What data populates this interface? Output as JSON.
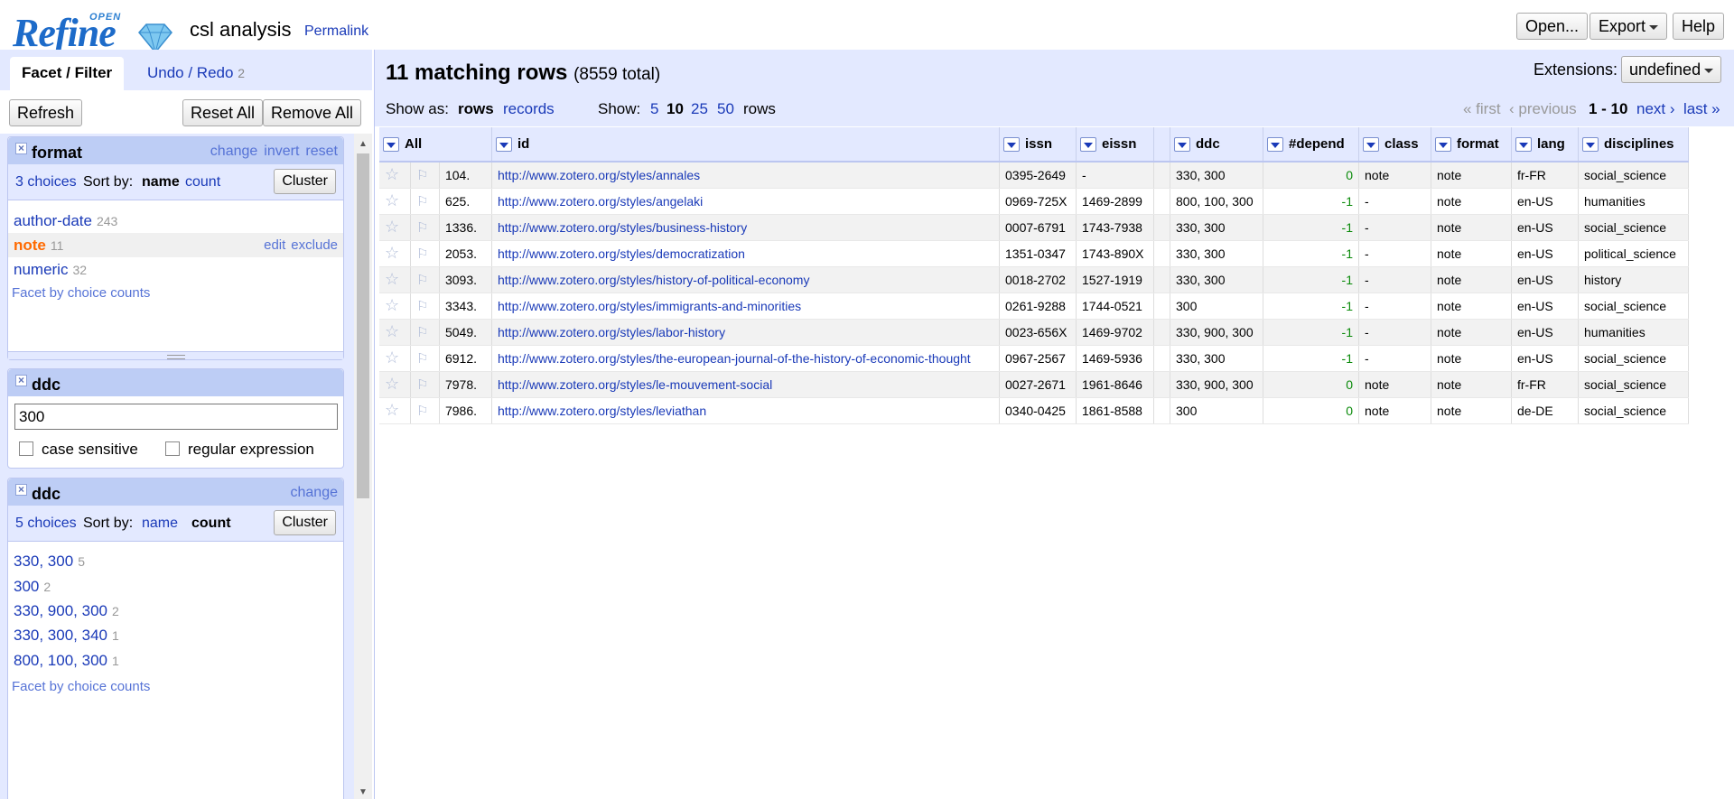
{
  "header": {
    "logo_open": "OPEN",
    "logo_refine": "Refine",
    "project_title": "csl analysis",
    "permalink": "Permalink",
    "buttons": {
      "open": "Open...",
      "export": "Export",
      "help": "Help"
    }
  },
  "left": {
    "tabs": {
      "facet_filter": "Facet / Filter",
      "undo_redo": "Undo / Redo",
      "undo_count": "2"
    },
    "refresh": "Refresh",
    "reset_all": "Reset All",
    "remove_all": "Remove All",
    "facet_format": {
      "title": "format",
      "actions": [
        "change",
        "invert",
        "reset"
      ],
      "choices_count": "3 choices",
      "sort_by": "Sort by:",
      "sort_name": "name",
      "sort_count": "count",
      "cluster": "Cluster",
      "choices": [
        {
          "label": "author-date",
          "count": "243"
        },
        {
          "label": "note",
          "count": "11",
          "edit": "edit",
          "exclude": "exclude"
        },
        {
          "label": "numeric",
          "count": "32"
        }
      ],
      "footer": "Facet by choice counts"
    },
    "facet_ddc_text": {
      "title": "ddc",
      "value": "300",
      "case_sensitive": "case sensitive",
      "regular_expression": "regular expression"
    },
    "facet_ddc_list": {
      "title": "ddc",
      "action": "change",
      "choices_count": "5 choices",
      "sort_by": "Sort by:",
      "sort_name": "name",
      "sort_count": "count",
      "cluster": "Cluster",
      "choices": [
        {
          "label": "330, 300",
          "count": "5"
        },
        {
          "label": "300",
          "count": "2"
        },
        {
          "label": "330, 900, 300",
          "count": "2"
        },
        {
          "label": "330, 300, 340",
          "count": "1"
        },
        {
          "label": "800, 100, 300",
          "count": "1"
        }
      ],
      "footer": "Facet by choice counts"
    }
  },
  "right": {
    "matching": "11 matching rows",
    "total": "(8559 total)",
    "extensions_label": "Extensions:",
    "extensions_value": "undefined",
    "show_as": "Show as:",
    "rows_mode": "rows",
    "records_mode": "records",
    "show": "Show:",
    "page_sizes": [
      "5",
      "10",
      "25",
      "50"
    ],
    "rows_word": "rows",
    "pager": {
      "first": "« first",
      "previous": "‹ previous",
      "range": "1 - 10",
      "next": "next ›",
      "last": "last »"
    },
    "columns": [
      "All",
      "id",
      "issn",
      "eissn",
      "",
      "ddc",
      "#depend",
      "class",
      "format",
      "lang",
      "disciplines"
    ],
    "rows": [
      {
        "idx": "104.",
        "id": "http://www.zotero.org/styles/annales",
        "issn": "0395-2649",
        "eissn": "-",
        "ddc": "330, 300",
        "depend": "0",
        "class": "note",
        "format": "note",
        "lang": "fr-FR",
        "disciplines": "social_science"
      },
      {
        "idx": "625.",
        "id": "http://www.zotero.org/styles/angelaki",
        "issn": "0969-725X",
        "eissn": "1469-2899",
        "ddc": "800, 100, 300",
        "depend": "-1",
        "class": "-",
        "format": "note",
        "lang": "en-US",
        "disciplines": "humanities"
      },
      {
        "idx": "1336.",
        "id": "http://www.zotero.org/styles/business-history",
        "issn": "0007-6791",
        "eissn": "1743-7938",
        "ddc": "330, 300",
        "depend": "-1",
        "class": "-",
        "format": "note",
        "lang": "en-US",
        "disciplines": "social_science"
      },
      {
        "idx": "2053.",
        "id": "http://www.zotero.org/styles/democratization",
        "issn": "1351-0347",
        "eissn": "1743-890X",
        "ddc": "330, 300",
        "depend": "-1",
        "class": "-",
        "format": "note",
        "lang": "en-US",
        "disciplines": "political_science"
      },
      {
        "idx": "3093.",
        "id": "http://www.zotero.org/styles/history-of-political-economy",
        "issn": "0018-2702",
        "eissn": "1527-1919",
        "ddc": "330, 300",
        "depend": "-1",
        "class": "-",
        "format": "note",
        "lang": "en-US",
        "disciplines": "history"
      },
      {
        "idx": "3343.",
        "id": "http://www.zotero.org/styles/immigrants-and-minorities",
        "issn": "0261-9288",
        "eissn": "1744-0521",
        "ddc": "300",
        "depend": "-1",
        "class": "-",
        "format": "note",
        "lang": "en-US",
        "disciplines": "social_science"
      },
      {
        "idx": "5049.",
        "id": "http://www.zotero.org/styles/labor-history",
        "issn": "0023-656X",
        "eissn": "1469-9702",
        "ddc": "330, 900, 300",
        "depend": "-1",
        "class": "-",
        "format": "note",
        "lang": "en-US",
        "disciplines": "humanities"
      },
      {
        "idx": "6912.",
        "id": "http://www.zotero.org/styles/the-european-journal-of-the-history-of-economic-thought",
        "issn": "0967-2567",
        "eissn": "1469-5936",
        "ddc": "330, 300",
        "depend": "-1",
        "class": "-",
        "format": "note",
        "lang": "en-US",
        "disciplines": "social_science"
      },
      {
        "idx": "7978.",
        "id": "http://www.zotero.org/styles/le-mouvement-social",
        "issn": "0027-2671",
        "eissn": "1961-8646",
        "ddc": "330, 900, 300",
        "depend": "0",
        "class": "note",
        "format": "note",
        "lang": "fr-FR",
        "disciplines": "social_science"
      },
      {
        "idx": "7986.",
        "id": "http://www.zotero.org/styles/leviathan",
        "issn": "0340-0425",
        "eissn": "1861-8588",
        "ddc": "300",
        "depend": "0",
        "class": "note",
        "format": "note",
        "lang": "de-DE",
        "disciplines": "social_science"
      }
    ]
  }
}
